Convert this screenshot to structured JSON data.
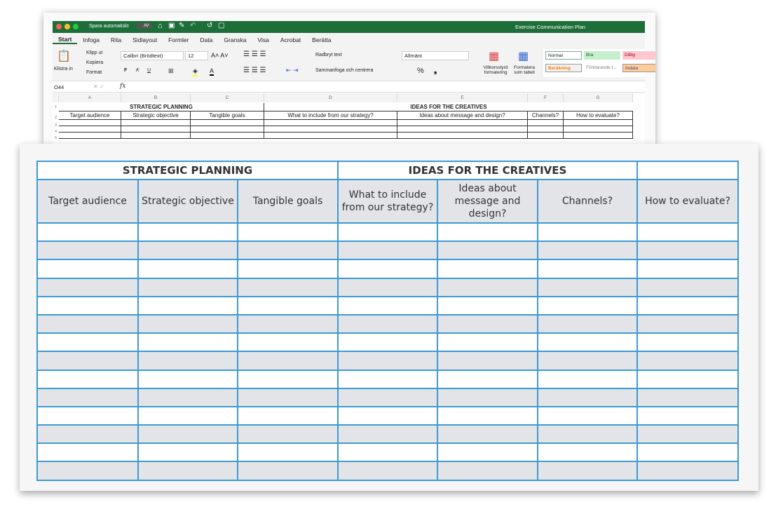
{
  "excel": {
    "autosave_label": "Spara automatiskt",
    "autosave_state": "AV",
    "doc_title": "Exercise Communication Plan",
    "tabs": [
      "Start",
      "Infoga",
      "Rita",
      "Sidlayout",
      "Formler",
      "Data",
      "Granska",
      "Visa",
      "Acrobat",
      "Berätta"
    ],
    "ribbon": {
      "paste": "Klistra in",
      "cut": "Klipp ut",
      "copy": "Kopiera",
      "format": "Format",
      "font": "Calibri (Brödtext)",
      "size": "12",
      "bold": "F",
      "italic": "K",
      "underline": "U",
      "wrap": "Radbryt text",
      "merge": "Sammanfoga och centrera",
      "number_format": "Allmänt",
      "percent": "%",
      "comma": "❟",
      "cond_format": "Villkorsstyrd formatering",
      "format_table": "Formatera som tabell"
    },
    "styles": [
      {
        "label": "Normal",
        "bg": "#ffffff",
        "fg": "#000000"
      },
      {
        "label": "Bra",
        "bg": "#c6efce",
        "fg": "#006100"
      },
      {
        "label": "Dålig",
        "bg": "#ffc7ce",
        "fg": "#9c0006"
      },
      {
        "label": "Beräkning",
        "bg": "#f2f2f2",
        "fg": "#fa7d00"
      },
      {
        "label": "Förklarande t...",
        "bg": "#ffffff",
        "fg": "#7f7f7f"
      },
      {
        "label": "Indata",
        "bg": "#ffcc99",
        "fg": "#3f3f76"
      }
    ],
    "name_box": "O44",
    "fx": "fx",
    "columns": [
      "A",
      "B",
      "C",
      "D",
      "E",
      "F",
      "G"
    ],
    "row_numbers": [
      "1",
      "2",
      "3",
      "4",
      "5"
    ],
    "group1": "STRATEGIC PLANNING",
    "group2": "IDEAS FOR THE CREATIVES",
    "headers": [
      "Target audience",
      "Strategic objective",
      "Tangible goals",
      "What to include from our strategy?",
      "Ideas about message and design?",
      "Channels?",
      "How to evaluate?"
    ]
  },
  "table": {
    "group1": "STRATEGIC PLANNING",
    "group2": "IDEAS FOR THE CREATIVES",
    "headers": [
      "Target audience",
      "Strategic objective",
      "Tangible goals",
      "What to include from our strategy?",
      "Ideas about message and design?",
      "Channels?",
      "How to evaluate?"
    ],
    "empty_rows": 14,
    "border_color": "#3d9bd3",
    "stripe_color": "#e3e4e8"
  }
}
